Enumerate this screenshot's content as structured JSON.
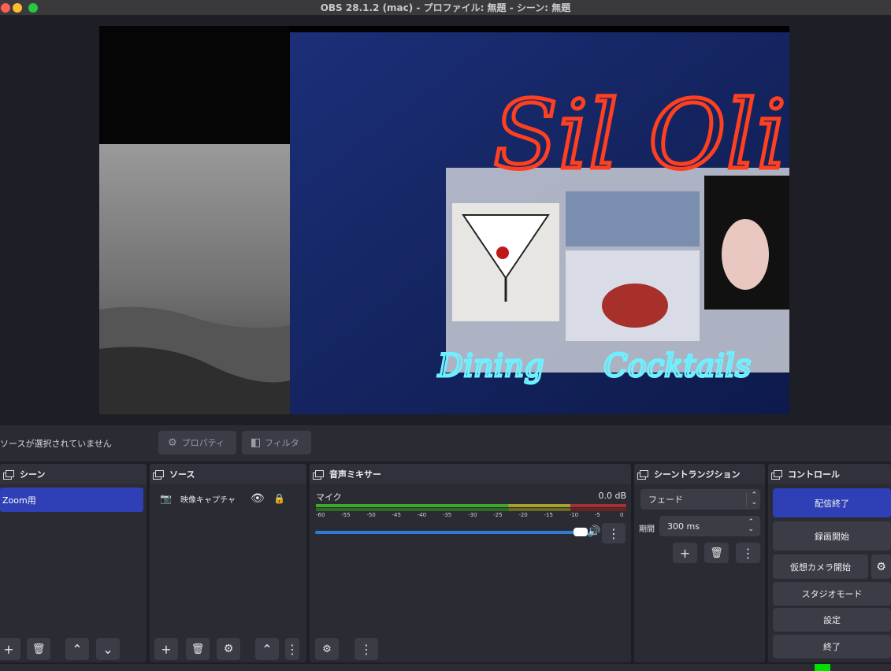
{
  "window": {
    "title": "OBS 28.1.2 (mac) - プロファイル: 無題 - シーン: 無題"
  },
  "preview": {
    "sign_text": "Sil Oli",
    "neon1": "Dining",
    "neon2": "Cocktails"
  },
  "context_bar": {
    "no_source": "ソースが選択されていません",
    "properties": "プロパティ",
    "filters": "フィルタ"
  },
  "scenes": {
    "title": "シーン",
    "items": [
      "Zoom用"
    ]
  },
  "sources": {
    "title": "ソース",
    "items": [
      "映像キャプチャ"
    ]
  },
  "mixer": {
    "title": "音声ミキサー",
    "channel": "マイク",
    "level": "0.0 dB",
    "ticks": [
      "-60",
      "-55",
      "-50",
      "-45",
      "-40",
      "-35",
      "-30",
      "-25",
      "-20",
      "-15",
      "-10",
      "-5",
      "0"
    ],
    "volume_fraction": 1.0
  },
  "transitions": {
    "title": "シーントランジション",
    "type": "フェード",
    "duration_label": "期間",
    "duration": "300 ms"
  },
  "controls": {
    "title": "コントロール",
    "stop_stream": "配信終了",
    "start_record": "録画開始",
    "virtual_cam": "仮想カメラ開始",
    "studio_mode": "スタジオモード",
    "settings": "設定",
    "exit": "終了"
  },
  "colors": {
    "accent": "#2f3fb5",
    "panel": "#2a2b33",
    "bg": "#1e1f26",
    "live": "#00e000"
  }
}
